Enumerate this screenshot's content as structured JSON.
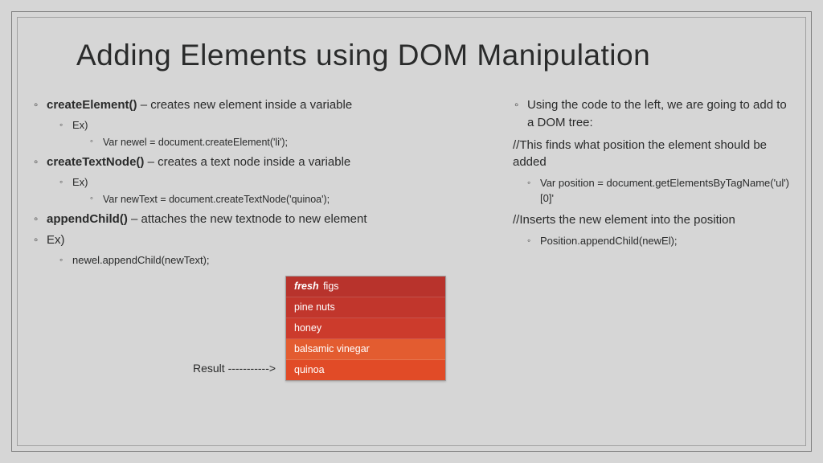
{
  "title": "Adding Elements using DOM Manipulation",
  "left": {
    "b1_strong": "createElement()",
    "b1_rest": " – creates new element inside a variable",
    "b1_ex": "Ex)",
    "b1_code": "Var newel = document.createElement('li');",
    "b2_strong": "createTextNode()",
    "b2_rest": " – creates a text node inside a variable",
    "b2_ex": "Ex)",
    "b2_code": "Var newText = document.createTextNode('quinoa');",
    "b3_strong": "appendChild()",
    "b3_rest": " – attaches the new textnode to new element",
    "b3_ex": "Ex)",
    "b3_code": "newel.appendChild(newText);",
    "result_label": "Result ----------->"
  },
  "right": {
    "intro": "Using the code to the left, we are going to add to a DOM tree:",
    "c1": "//This finds what position the element should be added",
    "c1_code": "Var position = document.getElementsByTagName('ul')[0]'",
    "c2": "//Inserts the new element into the position",
    "c2_code": "Position.appendChild(newEl);"
  },
  "listbox": [
    {
      "bold": "fresh",
      "rest": " figs",
      "bg": "#b8332c"
    },
    {
      "bold": "",
      "rest": "pine nuts",
      "bg": "#c1362c"
    },
    {
      "bold": "",
      "rest": "honey",
      "bg": "#cc3b2c"
    },
    {
      "bold": "",
      "rest": "balsamic vinegar",
      "bg": "#e35c30"
    },
    {
      "bold": "",
      "rest": "quinoa",
      "bg": "#e14b27"
    }
  ]
}
